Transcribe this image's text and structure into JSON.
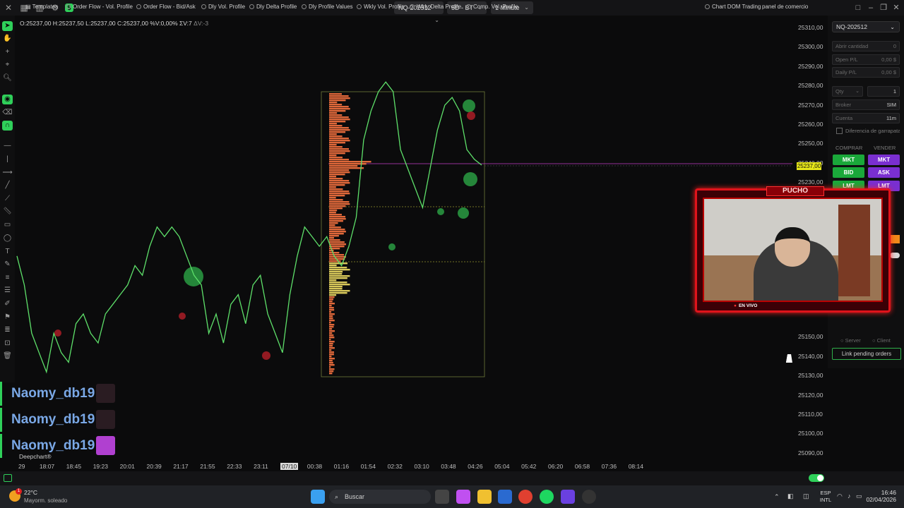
{
  "topbar": {
    "symbol": "NQ-202512",
    "data_mode": "5D - BT",
    "timeframe": "1 Minute",
    "icons": [
      "close-icon",
      "layout-icon",
      "bar-chart-icon",
      "settings-icon",
      "dollar-icon"
    ]
  },
  "ohlc": {
    "text": "O:25237,00  H:25237,50  L:25237,00  C:25237,00  %V:0,00%  ΣV:7",
    "delta": "ΔV:-3"
  },
  "chart_data": {
    "type": "line",
    "title": "",
    "xlabel": "",
    "ylabel": "",
    "last_price": "25237,00",
    "y_ticks": [
      "25310,00",
      "25300,00",
      "25290,00",
      "25280,00",
      "25270,00",
      "25260,00",
      "25250,00",
      "25240,00",
      "25230,00",
      "25150,00",
      "25140,00",
      "25130,00",
      "25120,00",
      "25110,00",
      "25100,00",
      "25090,00"
    ],
    "ylim": [
      25085,
      25313
    ],
    "x_ticks": [
      "29",
      "18:07",
      "18:45",
      "19:23",
      "20:01",
      "20:39",
      "21:17",
      "21:55",
      "22:33",
      "23:11",
      "07/10",
      "00:38",
      "01:16",
      "01:54",
      "02:32",
      "03:10",
      "03:48",
      "04:26",
      "05:04",
      "05:42",
      "06:20",
      "06:58",
      "07:36",
      "08:14"
    ],
    "highlighted_x_tick": "07/10",
    "series": [
      {
        "values": [
          25190,
          25175,
          25150,
          25140,
          25130,
          25150,
          25140,
          25135,
          25155,
          25160,
          25150,
          25145,
          25160,
          25165,
          25170,
          25175,
          25185,
          25180,
          25195,
          25205,
          25200,
          25205,
          25200,
          25190,
          25180,
          25175,
          25150,
          25160,
          25145,
          25165,
          25170,
          25155,
          25175,
          25180,
          25160,
          25150,
          25140,
          25170,
          25190,
          25205,
          25200,
          25195,
          25200,
          25190,
          25185,
          25195,
          25210,
          25250,
          25265,
          25275,
          25280,
          25275,
          25245,
          25235,
          25225,
          25215,
          25235,
          25255,
          25268,
          25272,
          25265,
          25245,
          25240,
          25237
        ]
      }
    ],
    "grid": false
  },
  "deepchart": "Deepchart®",
  "chat": [
    {
      "name": "Naomy_db19"
    },
    {
      "name": "Naomy_db19"
    },
    {
      "name": "Naomy_db19"
    }
  ],
  "right_panel": {
    "symbol": "NQ-202512",
    "fields": [
      {
        "label": "Abrir cantidad",
        "value": "0"
      },
      {
        "label": "Open P/L",
        "value": "0,00 $"
      },
      {
        "label": "Daily P/L",
        "value": "0,00 $"
      }
    ],
    "qty_label": "Qty",
    "qty_value": "1",
    "broker_label": "Broker",
    "broker_value": "SIM",
    "account_label": "Cuenta",
    "account_value": "11m",
    "checkbox_label": "Diferencia de garrapata",
    "buy_label": "COMPRAR",
    "sell_label": "VENDER",
    "buy_buttons": [
      "MKT",
      "BID",
      "LMT"
    ],
    "sell_buttons": [
      "MKT",
      "ASK",
      "LMT"
    ],
    "server_label": "Server",
    "client_label": "Client",
    "link_pending": "Link pending orders"
  },
  "bottombar": {
    "templates": "Templates",
    "items": [
      "Order Flow - Vol. Profile",
      "Order Flow - Bid/Ask",
      "Dly Vol. Profile",
      "Dly Delta Profile",
      "Dly Profile Values",
      "Wkly Vol. Profile",
      "Wkly Delta Profile",
      "Comp. Vol. Profile"
    ],
    "chart_dom": "Chart DOM Trading",
    "panel": "panel de comercio"
  },
  "stream": {
    "title": "PUCHO",
    "live": "EN VIVO"
  },
  "taskbar": {
    "temp": "22°C",
    "weather": "Mayorm. soleado",
    "notif": "1",
    "search": "Buscar",
    "lang1": "ESP",
    "lang2": "INTL",
    "time": "16:46",
    "date": "02/04/2026"
  }
}
